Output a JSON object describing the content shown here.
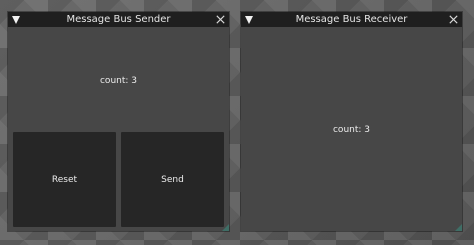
{
  "windows": {
    "sender": {
      "title": "Message Bus Sender",
      "count_text": "count: 3",
      "buttons": {
        "reset": "Reset",
        "send": "Send"
      }
    },
    "receiver": {
      "title": "Message Bus Receiver",
      "count_text": "count: 3"
    }
  },
  "icons": {
    "collapse": "triangle-down-icon",
    "close": "close-x-icon",
    "resize": "resize-grip-icon"
  },
  "colors": {
    "titlebar": "#1f1f1f",
    "window_bg": "#474747",
    "button_bg": "#262626",
    "resize_grip": "#3f6e66"
  }
}
